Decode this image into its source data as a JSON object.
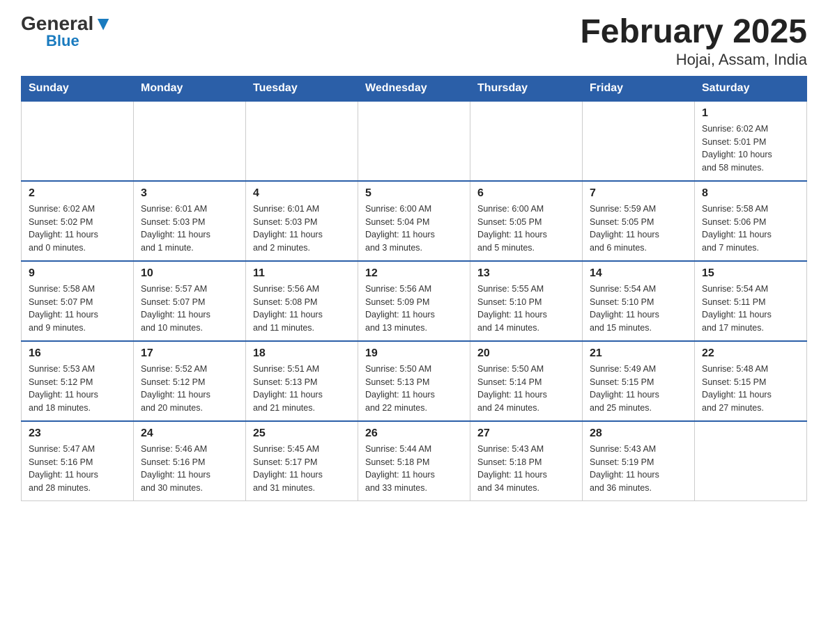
{
  "logo": {
    "general": "General",
    "blue": "Blue",
    "triangle": "▼"
  },
  "title": "February 2025",
  "subtitle": "Hojai, Assam, India",
  "weekdays": [
    "Sunday",
    "Monday",
    "Tuesday",
    "Wednesday",
    "Thursday",
    "Friday",
    "Saturday"
  ],
  "weeks": [
    [
      {
        "day": "",
        "info": ""
      },
      {
        "day": "",
        "info": ""
      },
      {
        "day": "",
        "info": ""
      },
      {
        "day": "",
        "info": ""
      },
      {
        "day": "",
        "info": ""
      },
      {
        "day": "",
        "info": ""
      },
      {
        "day": "1",
        "info": "Sunrise: 6:02 AM\nSunset: 5:01 PM\nDaylight: 10 hours\nand 58 minutes."
      }
    ],
    [
      {
        "day": "2",
        "info": "Sunrise: 6:02 AM\nSunset: 5:02 PM\nDaylight: 11 hours\nand 0 minutes."
      },
      {
        "day": "3",
        "info": "Sunrise: 6:01 AM\nSunset: 5:03 PM\nDaylight: 11 hours\nand 1 minute."
      },
      {
        "day": "4",
        "info": "Sunrise: 6:01 AM\nSunset: 5:03 PM\nDaylight: 11 hours\nand 2 minutes."
      },
      {
        "day": "5",
        "info": "Sunrise: 6:00 AM\nSunset: 5:04 PM\nDaylight: 11 hours\nand 3 minutes."
      },
      {
        "day": "6",
        "info": "Sunrise: 6:00 AM\nSunset: 5:05 PM\nDaylight: 11 hours\nand 5 minutes."
      },
      {
        "day": "7",
        "info": "Sunrise: 5:59 AM\nSunset: 5:05 PM\nDaylight: 11 hours\nand 6 minutes."
      },
      {
        "day": "8",
        "info": "Sunrise: 5:58 AM\nSunset: 5:06 PM\nDaylight: 11 hours\nand 7 minutes."
      }
    ],
    [
      {
        "day": "9",
        "info": "Sunrise: 5:58 AM\nSunset: 5:07 PM\nDaylight: 11 hours\nand 9 minutes."
      },
      {
        "day": "10",
        "info": "Sunrise: 5:57 AM\nSunset: 5:07 PM\nDaylight: 11 hours\nand 10 minutes."
      },
      {
        "day": "11",
        "info": "Sunrise: 5:56 AM\nSunset: 5:08 PM\nDaylight: 11 hours\nand 11 minutes."
      },
      {
        "day": "12",
        "info": "Sunrise: 5:56 AM\nSunset: 5:09 PM\nDaylight: 11 hours\nand 13 minutes."
      },
      {
        "day": "13",
        "info": "Sunrise: 5:55 AM\nSunset: 5:10 PM\nDaylight: 11 hours\nand 14 minutes."
      },
      {
        "day": "14",
        "info": "Sunrise: 5:54 AM\nSunset: 5:10 PM\nDaylight: 11 hours\nand 15 minutes."
      },
      {
        "day": "15",
        "info": "Sunrise: 5:54 AM\nSunset: 5:11 PM\nDaylight: 11 hours\nand 17 minutes."
      }
    ],
    [
      {
        "day": "16",
        "info": "Sunrise: 5:53 AM\nSunset: 5:12 PM\nDaylight: 11 hours\nand 18 minutes."
      },
      {
        "day": "17",
        "info": "Sunrise: 5:52 AM\nSunset: 5:12 PM\nDaylight: 11 hours\nand 20 minutes."
      },
      {
        "day": "18",
        "info": "Sunrise: 5:51 AM\nSunset: 5:13 PM\nDaylight: 11 hours\nand 21 minutes."
      },
      {
        "day": "19",
        "info": "Sunrise: 5:50 AM\nSunset: 5:13 PM\nDaylight: 11 hours\nand 22 minutes."
      },
      {
        "day": "20",
        "info": "Sunrise: 5:50 AM\nSunset: 5:14 PM\nDaylight: 11 hours\nand 24 minutes."
      },
      {
        "day": "21",
        "info": "Sunrise: 5:49 AM\nSunset: 5:15 PM\nDaylight: 11 hours\nand 25 minutes."
      },
      {
        "day": "22",
        "info": "Sunrise: 5:48 AM\nSunset: 5:15 PM\nDaylight: 11 hours\nand 27 minutes."
      }
    ],
    [
      {
        "day": "23",
        "info": "Sunrise: 5:47 AM\nSunset: 5:16 PM\nDaylight: 11 hours\nand 28 minutes."
      },
      {
        "day": "24",
        "info": "Sunrise: 5:46 AM\nSunset: 5:16 PM\nDaylight: 11 hours\nand 30 minutes."
      },
      {
        "day": "25",
        "info": "Sunrise: 5:45 AM\nSunset: 5:17 PM\nDaylight: 11 hours\nand 31 minutes."
      },
      {
        "day": "26",
        "info": "Sunrise: 5:44 AM\nSunset: 5:18 PM\nDaylight: 11 hours\nand 33 minutes."
      },
      {
        "day": "27",
        "info": "Sunrise: 5:43 AM\nSunset: 5:18 PM\nDaylight: 11 hours\nand 34 minutes."
      },
      {
        "day": "28",
        "info": "Sunrise: 5:43 AM\nSunset: 5:19 PM\nDaylight: 11 hours\nand 36 minutes."
      },
      {
        "day": "",
        "info": ""
      }
    ]
  ]
}
